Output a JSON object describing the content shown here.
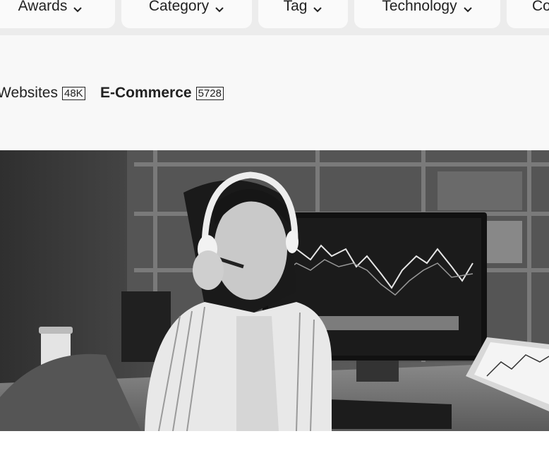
{
  "filters": [
    {
      "label": "Awards"
    },
    {
      "label": "Category"
    },
    {
      "label": "Tag"
    },
    {
      "label": "Technology"
    },
    {
      "label": "Co"
    }
  ],
  "breadcrumbs": [
    {
      "label": "Websites",
      "count": "48K"
    },
    {
      "label": "E-Commerce",
      "count": "5728"
    }
  ],
  "hero": {
    "description": "Woman wearing a headset in front of trading chart monitors",
    "tone": "grayscale"
  }
}
